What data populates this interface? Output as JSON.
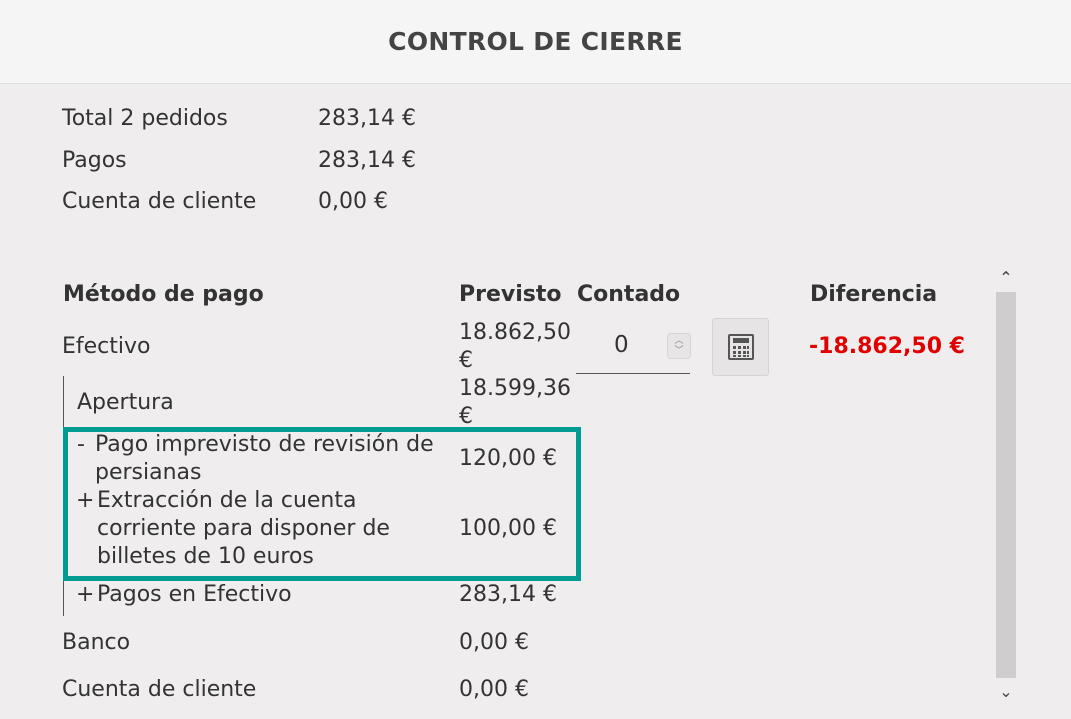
{
  "header": {
    "title": "CONTROL DE CIERRE"
  },
  "summary": {
    "rows": [
      {
        "label": "Total 2 pedidos",
        "value": "283,14 €"
      },
      {
        "label": "Pagos",
        "value": "283,14 €"
      },
      {
        "label": "Cuenta de cliente",
        "value": "0,00 €"
      }
    ]
  },
  "table": {
    "headers": {
      "method": "Método de pago",
      "expected": "Previsto",
      "counted": "Contado",
      "difference": "Diferencia"
    },
    "efectivo": {
      "label": "Efectivo",
      "expected": "18.862,50 €",
      "counted_value": "0",
      "difference": "-18.862,50 €"
    },
    "sub_rows": [
      {
        "sign": "",
        "label": "Apertura",
        "value": "18.599,36 €"
      },
      {
        "sign": "-",
        "label": "Pago imprevisto de revisión de persianas",
        "value": "120,00 €"
      },
      {
        "sign": "+",
        "label": "Extracción de la cuenta corriente para disponer de billetes de 10 euros",
        "value": "100,00 €"
      },
      {
        "sign": "+",
        "label": "Pagos en Efectivo",
        "value": "283,14 €"
      }
    ],
    "banco": {
      "label": "Banco",
      "expected": "0,00 €"
    },
    "cuenta_cliente": {
      "label": "Cuenta de cliente",
      "expected": "0,00 €"
    }
  },
  "icons": {
    "calculator": "calculator-icon",
    "spinner": "spinner-icon",
    "scroll_up": "chevron-up-icon",
    "scroll_down": "chevron-down-icon"
  },
  "colors": {
    "highlight": "#009c94",
    "negative": "#e00000",
    "background": "#efedee"
  }
}
